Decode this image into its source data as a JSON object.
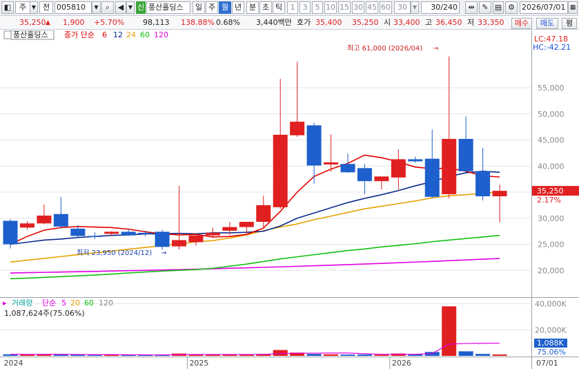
{
  "toolbar": {
    "market": "주",
    "prev_label": "전",
    "code": "005810",
    "badge": "신",
    "name": "풍산홀딩스",
    "periods": [
      "일",
      "주",
      "월",
      "년",
      "분",
      "초",
      "틱"
    ],
    "active_period": "월",
    "intervals": [
      "1",
      "3",
      "5",
      "10",
      "15",
      "30",
      "45",
      "60"
    ],
    "interval_value": "30",
    "count": "30/240",
    "date": "2026/07/01"
  },
  "quote": {
    "price": "35,250",
    "change": "1,900",
    "change_pct": "+5.70%",
    "volume": "98,113",
    "vol_ratio": "138.88%",
    "turnover": "0.68%",
    "amount": "3,440백만",
    "ask_label": "호가",
    "ask1": "35,400",
    "ask2": "35,250",
    "open_label": "시",
    "open": "33,400",
    "high_label": "고",
    "high": "36,450",
    "low_label": "저",
    "low": "33,350",
    "buy_label": "매수",
    "sell_label": "매도",
    "eval_label": "평"
  },
  "legend": {
    "stock": "풍산홀딩스",
    "price_label": "종가 단순",
    "ma": [
      {
        "period": "6",
        "color": "#e00000"
      },
      {
        "period": "12",
        "color": "#0b2a8a"
      },
      {
        "period": "24",
        "color": "#e8a000"
      },
      {
        "period": "60",
        "color": "#10c010"
      },
      {
        "period": "120",
        "color": "#e000e0"
      }
    ],
    "volume_label": "거래량",
    "volume_simple": "단순",
    "volume_ma": [
      {
        "period": "5",
        "color": "#e000e0"
      },
      {
        "period": "20",
        "color": "#e8a000"
      },
      {
        "period": "60",
        "color": "#10c010"
      },
      {
        "period": "120",
        "color": "#888888"
      }
    ],
    "volume_value": "1,087,624주(75.06%)"
  },
  "right_labels": {
    "lc": "LC:47.18",
    "hc": "HC:-42.21"
  },
  "annotations": {
    "max": "최고 61,000 (2026/04)",
    "min": "최저 23,950 (2024/12)"
  },
  "chart_data": {
    "type": "candlestick",
    "price_axis": {
      "min": 15000,
      "max": 66000,
      "ticks": [
        20000,
        25000,
        30000,
        35000,
        40000,
        45000,
        50000,
        55000
      ]
    },
    "price_tick_labels": [
      "20,000",
      "25,000",
      "30,000",
      "35,000",
      "40,000",
      "45,000",
      "50,000",
      "55,000"
    ],
    "current_price": {
      "label": "35,250",
      "value": 35250,
      "pct": "2.17%"
    },
    "x_labels": [
      {
        "label": "2024",
        "index": 0
      },
      {
        "label": "2025",
        "index": 11
      },
      {
        "label": "2026",
        "index": 23
      },
      {
        "label": "07/01",
        "index": 30
      }
    ],
    "candles": [
      {
        "o": 29500,
        "h": 29800,
        "l": 24200,
        "c": 25000
      },
      {
        "o": 28200,
        "h": 29400,
        "l": 27800,
        "c": 29000
      },
      {
        "o": 29000,
        "h": 32600,
        "l": 28800,
        "c": 30500
      },
      {
        "o": 30800,
        "h": 34100,
        "l": 28000,
        "c": 28400
      },
      {
        "o": 28000,
        "h": 28700,
        "l": 26200,
        "c": 26600
      },
      {
        "o": 26600,
        "h": 27300,
        "l": 26000,
        "c": 26400
      },
      {
        "o": 27000,
        "h": 27500,
        "l": 26600,
        "c": 27400
      },
      {
        "o": 27400,
        "h": 27900,
        "l": 26600,
        "c": 26700
      },
      {
        "o": 27200,
        "h": 27600,
        "l": 26500,
        "c": 27000
      },
      {
        "o": 27400,
        "h": 27800,
        "l": 24000,
        "c": 24500
      },
      {
        "o": 24600,
        "h": 36200,
        "l": 24000,
        "c": 25800
      },
      {
        "o": 25400,
        "h": 26300,
        "l": 24800,
        "c": 26700
      },
      {
        "o": 26700,
        "h": 28200,
        "l": 26200,
        "c": 27200
      },
      {
        "o": 27600,
        "h": 29300,
        "l": 26800,
        "c": 28300
      },
      {
        "o": 28300,
        "h": 29300,
        "l": 27100,
        "c": 29300
      },
      {
        "o": 29300,
        "h": 34300,
        "l": 28000,
        "c": 32500
      },
      {
        "o": 32100,
        "h": 56700,
        "l": 31800,
        "c": 46000
      },
      {
        "o": 45900,
        "h": 60000,
        "l": 45600,
        "c": 48500
      },
      {
        "o": 47800,
        "h": 48300,
        "l": 36600,
        "c": 40100
      },
      {
        "o": 40300,
        "h": 46100,
        "l": 38900,
        "c": 40700
      },
      {
        "o": 40400,
        "h": 42400,
        "l": 38700,
        "c": 38800
      },
      {
        "o": 39600,
        "h": 40400,
        "l": 34600,
        "c": 37100
      },
      {
        "o": 37100,
        "h": 38000,
        "l": 35500,
        "c": 38000
      },
      {
        "o": 37800,
        "h": 43200,
        "l": 35500,
        "c": 41300
      },
      {
        "o": 41300,
        "h": 41800,
        "l": 40600,
        "c": 40900
      },
      {
        "o": 41400,
        "h": 47000,
        "l": 33800,
        "c": 34100
      },
      {
        "o": 34600,
        "h": 61000,
        "l": 33800,
        "c": 45200
      },
      {
        "o": 45200,
        "h": 49500,
        "l": 38800,
        "c": 39000
      },
      {
        "o": 39000,
        "h": 43500,
        "l": 33400,
        "c": 34200
      },
      {
        "o": 34200,
        "h": 36450,
        "l": 29200,
        "c": 35250
      }
    ],
    "ma_lines": {
      "ma6": [
        25000,
        26500,
        27700,
        28200,
        28400,
        28300,
        28200,
        27900,
        27400,
        27000,
        26800,
        26900,
        26400,
        26500,
        26900,
        28100,
        31300,
        35000,
        38000,
        39400,
        40500,
        42100,
        41600,
        40800,
        39800,
        39500,
        39600,
        39000,
        38100,
        37900
      ],
      "ma12": [
        25000,
        25400,
        25800,
        26000,
        26300,
        26500,
        26700,
        26800,
        27000,
        27000,
        27100,
        27000,
        27200,
        27200,
        27300,
        27500,
        28500,
        30000,
        31000,
        32000,
        33000,
        33800,
        34500,
        35300,
        36200,
        37000,
        38000,
        38700,
        39000,
        38800
      ],
      "ma24": [
        21600,
        21950,
        22300,
        22650,
        23000,
        23350,
        23700,
        24050,
        24400,
        24750,
        25100,
        25450,
        25700,
        26200,
        26800,
        27600,
        28300,
        28900,
        29700,
        30400,
        31100,
        31800,
        32300,
        32800,
        33300,
        33900,
        34300,
        34500,
        34800,
        35000
      ],
      "ma60": [
        18400,
        18500,
        18650,
        18800,
        18950,
        19100,
        19300,
        19500,
        19700,
        19850,
        20000,
        20150,
        20400,
        20800,
        21200,
        21700,
        22200,
        22600,
        23000,
        23400,
        23800,
        24100,
        24500,
        24800,
        25100,
        25500,
        25800,
        26100,
        26400,
        26700
      ],
      "ma120": [
        19500,
        19560,
        19620,
        19680,
        19740,
        19800,
        19870,
        19940,
        20010,
        20080,
        20150,
        20230,
        20310,
        20400,
        20490,
        20580,
        20680,
        20780,
        20880,
        20990,
        21100,
        21220,
        21340,
        21460,
        21590,
        21720,
        21860,
        22000,
        22140,
        22280
      ]
    },
    "volume_axis": {
      "min": 0,
      "max": 44000,
      "ticks": [
        20000,
        40000
      ],
      "unit": "K"
    },
    "volume_tick_labels": [
      "20,000K",
      "40,000K"
    ],
    "volume_current": {
      "label": "1,088K",
      "pct": "75.06%"
    },
    "volume": [
      1200,
      1100,
      1300,
      1200,
      800,
      700,
      800,
      700,
      700,
      900,
      1800,
      1000,
      900,
      900,
      1000,
      1500,
      4500,
      2500,
      1500,
      1200,
      1000,
      1100,
      900,
      1800,
      1000,
      3000,
      38000,
      3500,
      1500,
      1100
    ],
    "volume_ma5": [
      1200,
      1150,
      1200,
      1200,
      1100,
      1000,
      1000,
      900,
      750,
      750,
      950,
      1050,
      1100,
      1100,
      1100,
      1100,
      1800,
      2100,
      2100,
      2200,
      2200,
      1700,
      1200,
      1300,
      1200,
      1800,
      9000,
      9500,
      9600,
      9700
    ]
  }
}
